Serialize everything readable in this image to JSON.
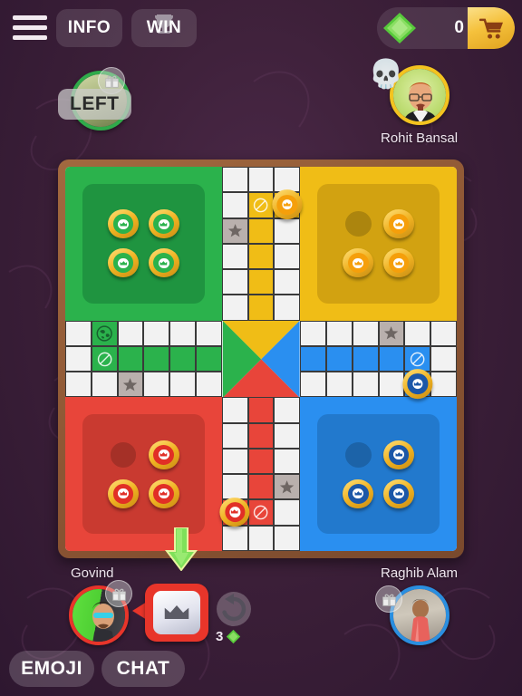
{
  "topbar": {
    "menu_icon": "hamburger-menu-icon",
    "info_label": "INFO",
    "win_label": "WIN",
    "trophy_icon": "trophy-icon",
    "gem_icon": "gem-icon",
    "coin_count": "0",
    "cart_icon": "shopping-cart-icon"
  },
  "players": [
    {
      "id": "green",
      "name": "",
      "status": "LEFT",
      "ring_color": "#2faa4a",
      "badge": "gift-icon"
    },
    {
      "id": "yellow",
      "name": "Rohit Bansal",
      "status": "",
      "ring_color": "#f3c31f",
      "badge": "skull-icon"
    },
    {
      "id": "red",
      "name": "Govind",
      "status": "",
      "ring_color": "#e8352a",
      "badge": "gift-icon"
    },
    {
      "id": "blue",
      "name": "Raghib Alam",
      "status": "",
      "ring_color": "#2a8fe0",
      "badge": "gift-icon"
    }
  ],
  "board": {
    "colors": {
      "green": "#2bb24c",
      "yellow": "#f0bd16",
      "red": "#e8453a",
      "blue": "#2a8ff0",
      "frame": "#8a5433",
      "cell": "#f2f2f2",
      "safe": "#b9b0ad"
    },
    "homes": [
      {
        "color_key": "green",
        "tokens_in_base": 4,
        "empty_slots": 0
      },
      {
        "color_key": "yellow",
        "tokens_in_base": 3,
        "empty_slots": 1
      },
      {
        "color_key": "red",
        "tokens_in_base": 3,
        "empty_slots": 1
      },
      {
        "color_key": "blue",
        "tokens_in_base": 3,
        "empty_slots": 1
      }
    ],
    "board_tokens": [
      {
        "color_key": "yellow",
        "col": 8,
        "row": 1
      },
      {
        "color_key": "blue",
        "col": 13,
        "row": 8
      },
      {
        "color_key": "red",
        "col": 6,
        "row": 13
      }
    ],
    "blocked_cells": [
      {
        "col": 7,
        "row": 1
      },
      {
        "col": 1,
        "row": 7
      },
      {
        "col": 13,
        "row": 7
      },
      {
        "col": 7,
        "row": 13
      }
    ],
    "safe_star_cells": [
      {
        "col": 6,
        "row": 2
      },
      {
        "col": 12,
        "row": 6
      },
      {
        "col": 2,
        "row": 8
      },
      {
        "col": 8,
        "row": 12
      }
    ],
    "start_globe_cell": {
      "col": 1,
      "row": 6,
      "color_key": "green",
      "icon": "globe-icon"
    },
    "center": {
      "top": "yellow",
      "right": "blue",
      "bottom": "red",
      "left": "green"
    }
  },
  "turn": {
    "arrow_icon": "down-arrow-icon",
    "active_player": "red",
    "dice_icon": "crown-dice-icon",
    "undo_icon": "undo-icon",
    "undo_count": "3",
    "undo_gem_icon": "gem-icon"
  },
  "bottombar": {
    "emoji_label": "EMOJI",
    "chat_label": "CHAT"
  }
}
